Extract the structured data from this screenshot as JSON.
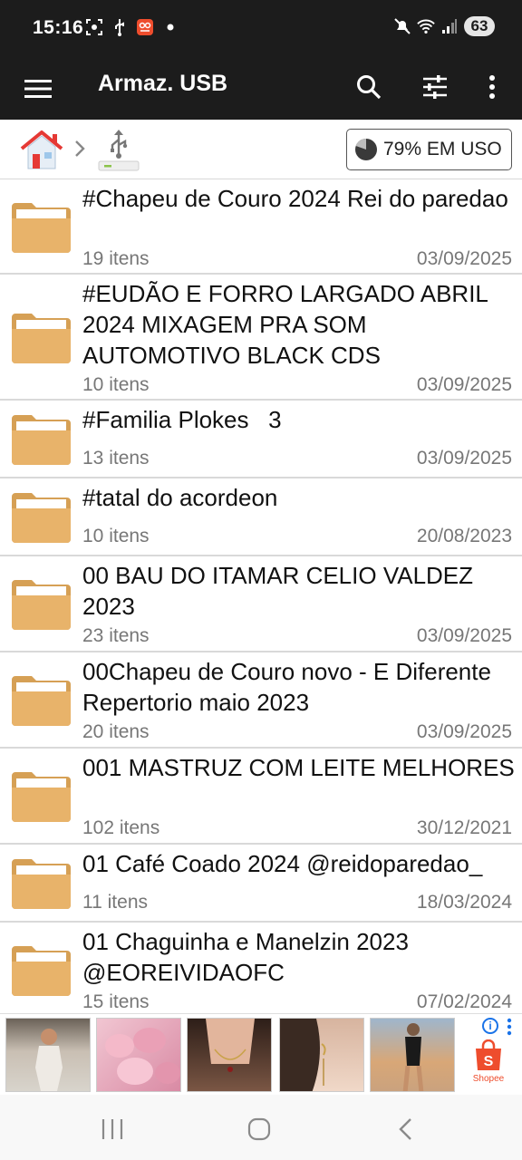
{
  "status_bar": {
    "time": "15:16",
    "battery": "63"
  },
  "app_bar": {
    "title": "Armaz. USB"
  },
  "breadcrumb": {
    "usage_label": "79% EM USO"
  },
  "folders": [
    {
      "name": "#Chapeu de Couro 2024 Rei do paredao",
      "count": "19 itens",
      "date": "03/09/2025"
    },
    {
      "name": "#EUDÃO E FORRO LARGADO ABRIL 2024 MIXAGEM PRA SOM AUTOMOTIVO BLACK CDS",
      "count": "10 itens",
      "date": "03/09/2025"
    },
    {
      "name": "#Familia Plokes   3",
      "count": "13 itens",
      "date": "03/09/2025"
    },
    {
      "name": "#tatal do acordeon",
      "count": "10 itens",
      "date": "20/08/2023"
    },
    {
      "name": "00 BAU DO ITAMAR CELIO VALDEZ 2023",
      "count": "23 itens",
      "date": "03/09/2025"
    },
    {
      "name": "00Chapeu de Couro novo - E Diferente  Repertorio maio 2023",
      "count": "20 itens",
      "date": "03/09/2025"
    },
    {
      "name": "001 MASTRUZ COM LEITE MELHORES",
      "count": "102 itens",
      "date": "30/12/2021"
    },
    {
      "name": "01 Café Coado 2024 @reidoparedao_",
      "count": "11 itens",
      "date": "18/03/2024"
    },
    {
      "name": "01 Chaguinha e Manelzin 2023 @EOREIVIDAOFC",
      "count": "15 itens",
      "date": "07/02/2024"
    }
  ],
  "ad": {
    "brand": "Shopee",
    "info": "i"
  },
  "colors": {
    "bar": "#1c1c1c",
    "folder": "#e8b36a",
    "folder_dark": "#d6a055"
  },
  "icons": [
    "menu-icon",
    "search-icon",
    "sliders-icon",
    "more-vert-icon",
    "home-icon",
    "chevron-right-icon",
    "usb-drive-icon",
    "pie-chart-icon",
    "folder-icon"
  ]
}
